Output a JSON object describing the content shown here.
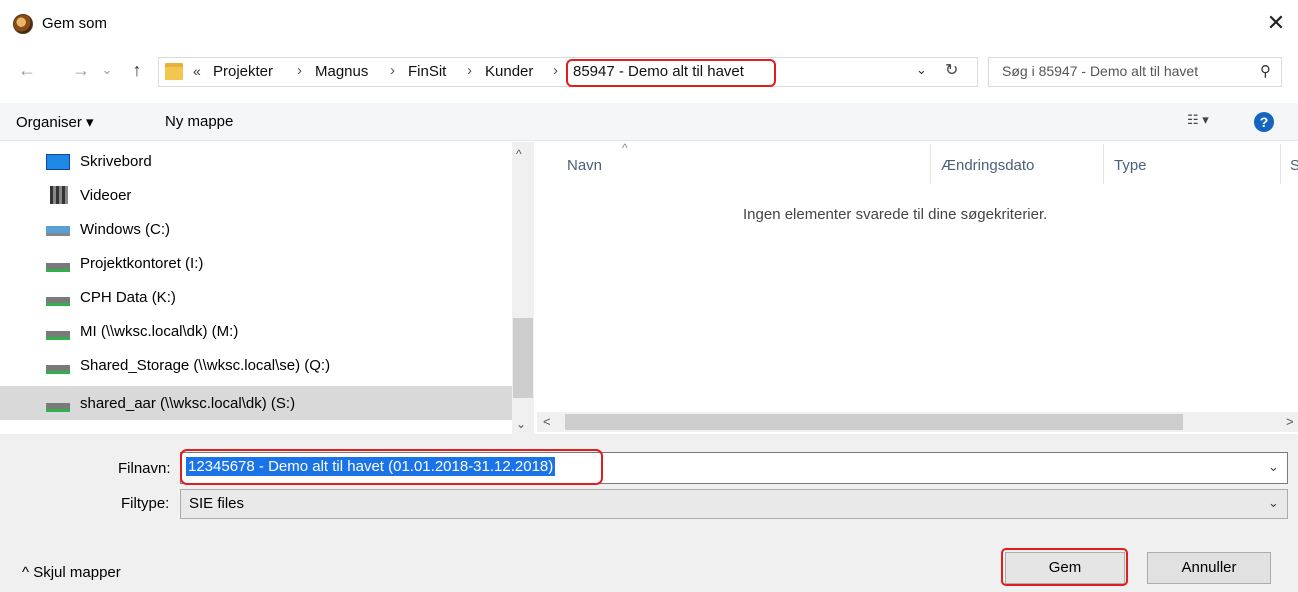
{
  "window": {
    "title": "Gem som",
    "close_glyph": "✕"
  },
  "nav": {
    "back_glyph": "←",
    "forward_glyph": "→",
    "history_glyph": "⌄",
    "up_glyph": "↑"
  },
  "breadcrumb": {
    "overflow": "«",
    "items": [
      "Projekter",
      "Magnus",
      "FinSit",
      "Kunder",
      "85947 - Demo alt til havet"
    ],
    "separator": "›"
  },
  "address": {
    "dropdown_glyph": "⌄",
    "refresh_glyph": "↻"
  },
  "search": {
    "placeholder": "Søg i 85947 - Demo alt til havet",
    "icon": "⚲"
  },
  "toolbar": {
    "organize_label": "Organiser ▾",
    "new_folder_label": "Ny mappe",
    "view_glyph": "☷ ▾",
    "help_glyph": "?"
  },
  "sidebar": {
    "items": [
      {
        "label": "Skrivebord",
        "icon": "desktop-icon"
      },
      {
        "label": "Videoer",
        "icon": "video-icon"
      },
      {
        "label": "Windows (C:)",
        "icon": "windows-drive-icon"
      },
      {
        "label": "Projektkontoret (I:)",
        "icon": "network-drive-icon"
      },
      {
        "label": "CPH Data (K:)",
        "icon": "network-drive-icon"
      },
      {
        "label": "MI (\\\\wksc.local\\dk) (M:)",
        "icon": "network-drive-icon"
      },
      {
        "label": "Shared_Storage (\\\\wksc.local\\se) (Q:)",
        "icon": "network-drive-icon"
      },
      {
        "label": "shared_aar (\\\\wksc.local\\dk) (S:)",
        "icon": "network-drive-icon",
        "selected": true
      }
    ],
    "scroll_up": "^",
    "scroll_down": "⌄"
  },
  "columns": {
    "name": "Navn",
    "modified": "Ændringsdato",
    "type": "Type",
    "size_partial": "S",
    "sort_glyph": "^"
  },
  "content": {
    "empty_message": "Ingen elementer svarede til dine søgekriterier."
  },
  "hscroll": {
    "left": "<",
    "right": ">"
  },
  "form": {
    "filename_label": "Filnavn:",
    "filename_value": "12345678 - Demo alt til havet (01.01.2018-31.12.2018)",
    "filetype_label": "Filtype:",
    "filetype_value": "SIE files",
    "dropdown_glyph": "⌄"
  },
  "footer": {
    "hide_folders_label": "^  Skjul mapper",
    "save_label": "Gem",
    "cancel_label": "Annuller"
  },
  "colors": {
    "highlight_red": "#e01e1e",
    "selection_blue": "#1a73e8",
    "help_blue": "#1565c0"
  }
}
